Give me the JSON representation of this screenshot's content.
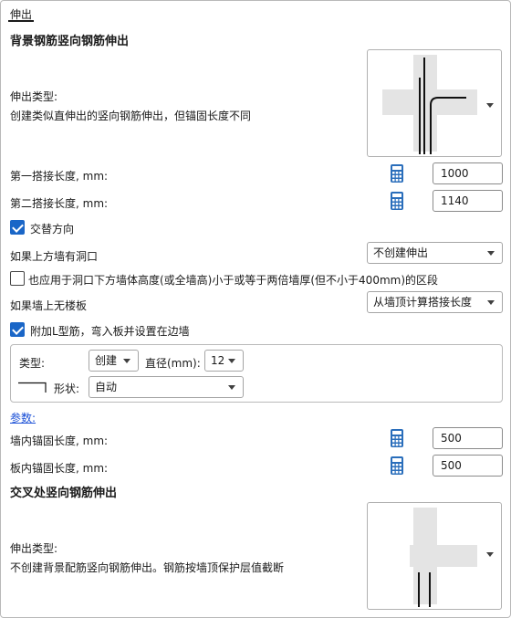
{
  "tab": {
    "title": "伸出"
  },
  "background": {
    "section_title": "背景钢筋竖向钢筋伸出",
    "ext_type_label": "伸出类型:",
    "ext_type_desc": "创建类似直伸出的竖向钢筋伸出，但锚固长度不同",
    "lap1": {
      "label": "第一搭接长度, mm:",
      "value": "1000"
    },
    "lap2": {
      "label": "第二搭接长度, mm:",
      "value": "1140"
    },
    "alternate": {
      "label": "交替方向",
      "checked": true
    },
    "opening": {
      "label": "如果上方墙有洞口",
      "value": "不创建伸出"
    },
    "apply_opening": {
      "label": "也应用于洞口下方墙体高度(或全墙高)小于或等于两倍墙厚(但不小于400mm)的区段",
      "checked": false
    },
    "no_slab": {
      "label": "如果墙上无楼板",
      "value": "从墙顶计算搭接长度"
    },
    "add_l": {
      "label": "附加L型筋，弯入板并设置在边墙",
      "checked": true
    },
    "l_group": {
      "type_label": "类型:",
      "type_value": "创建",
      "diameter_label": "直径(mm):",
      "diameter_value": "12",
      "shape_label": "形状:",
      "shape_value": "自动"
    },
    "params_link": "参数:",
    "anchor_wall": {
      "label": "墙内锚固长度, mm:",
      "value": "500"
    },
    "anchor_slab": {
      "label": "板内锚固长度, mm:",
      "value": "500"
    }
  },
  "cross": {
    "section_title": "交叉处竖向钢筋伸出",
    "ext_type_label": "伸出类型:",
    "ext_type_desc": "不创建背景配筋竖向钢筋伸出。钢筋按墙顶保护层值截断"
  },
  "icons": {
    "calculator": "calculator-icon",
    "dropdown": "chevron-down-icon",
    "check": "check-icon"
  },
  "colors": {
    "accent": "#1a66c7",
    "calc": "#2a6ebb",
    "link": "#1a4fd6",
    "preview_fill": "#e4e4e4"
  }
}
